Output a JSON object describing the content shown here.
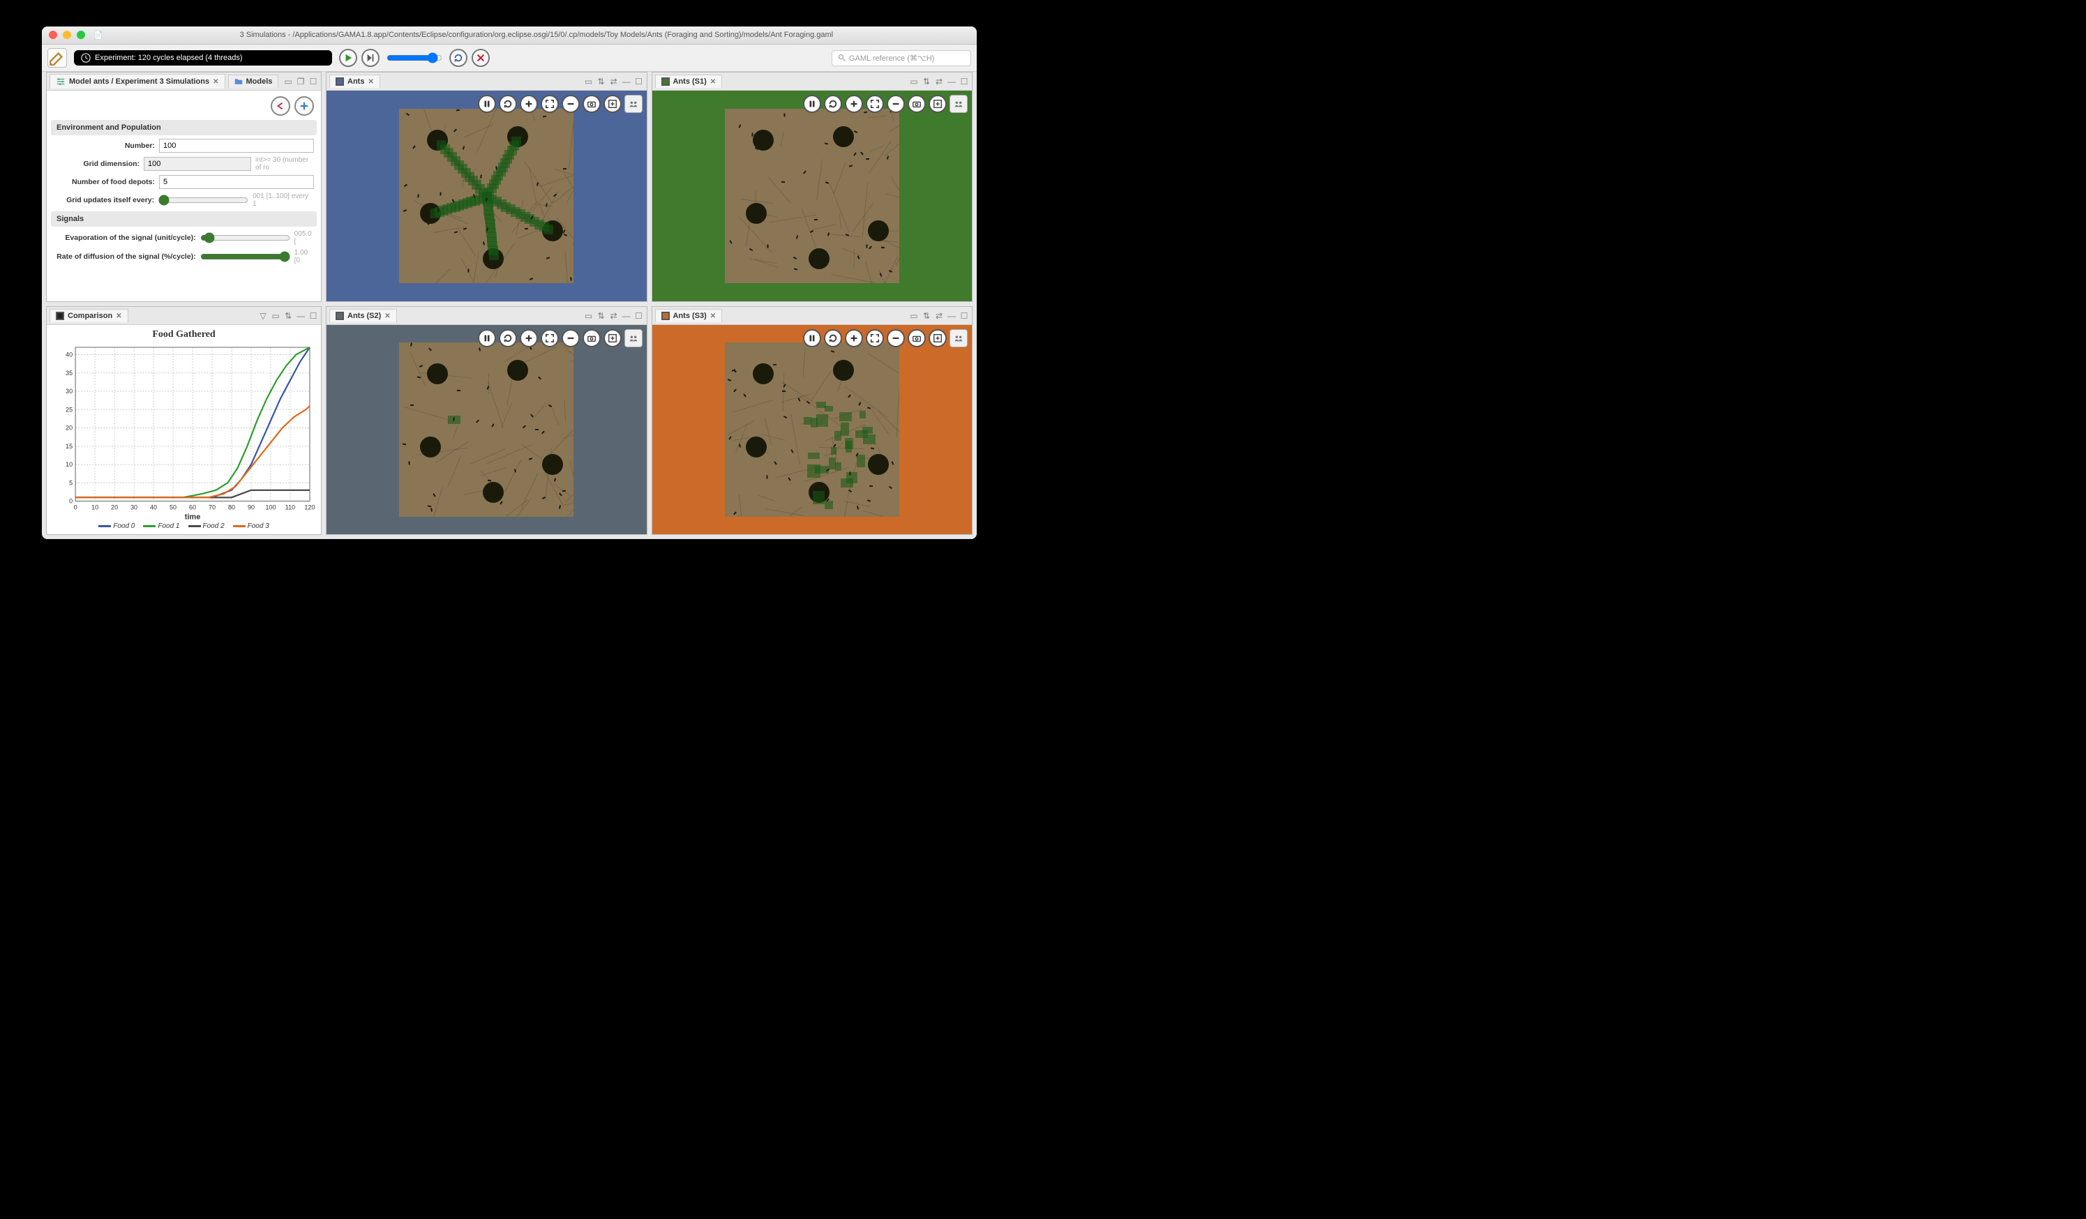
{
  "window": {
    "title": "3 Simulations - /Applications/GAMA1.8.app/Contents/Eclipse/configuration/org.eclipse.osgi/15/0/.cp/models/Toy Models/Ants (Foraging and Sorting)/models/Ant Foraging.gaml"
  },
  "toolbar": {
    "experiment_label": "Experiment: 120 cycles elapsed (4 threads)",
    "search_placeholder": "GAML reference (⌘⌥H)"
  },
  "left_panel": {
    "tab_model": "Model ants / Experiment 3 Simulations",
    "tab_models": "Models",
    "sect_env": "Environment and Population",
    "sect_signals": "Signals",
    "p_number_label": "Number:",
    "p_number_value": "100",
    "p_grid_label": "Grid dimension:",
    "p_grid_value": "100",
    "p_grid_hint": "int>= 30 (number of ro",
    "p_food_label": "Number of food depots:",
    "p_food_value": "5",
    "p_upd_label": "Grid updates itself every:",
    "p_upd_hint": "001 [1..100] every 1",
    "p_evap_label": "Evaporation of the signal (unit/cycle):",
    "p_evap_hint": "005.0 [",
    "p_diff_label": "Rate of diffusion of the signal (%/cycle):",
    "p_diff_hint": "1.00 [0"
  },
  "comparison": {
    "tab": "Comparison"
  },
  "sims": {
    "s0": {
      "tab": "Ants",
      "bg": "#4d6699"
    },
    "s1": {
      "tab": "Ants (S1)",
      "bg": "#3f7a2d"
    },
    "s2": {
      "tab": "Ants (S2)",
      "bg": "#5a6773"
    },
    "s3": {
      "tab": "Ants (S3)",
      "bg": "#cc6a29"
    }
  },
  "chart_data": {
    "type": "line",
    "title": "Food Gathered",
    "xlabel": "time",
    "ylabel": "",
    "xlim": [
      0,
      120
    ],
    "ylim": [
      0,
      42
    ],
    "x_ticks": [
      0,
      10,
      20,
      30,
      40,
      50,
      60,
      70,
      80,
      90,
      100,
      110,
      120
    ],
    "y_ticks": [
      0,
      5,
      10,
      15,
      20,
      25,
      30,
      35,
      40
    ],
    "series": [
      {
        "name": "Food 0",
        "color": "#3955a3",
        "x": [
          0,
          60,
          70,
          75,
          80,
          85,
          90,
          95,
          100,
          105,
          110,
          115,
          120
        ],
        "values": [
          1,
          1,
          1,
          2,
          3,
          6,
          10,
          16,
          22,
          28,
          33,
          38,
          42
        ]
      },
      {
        "name": "Food 1",
        "color": "#2f9e2f",
        "x": [
          0,
          55,
          65,
          72,
          78,
          83,
          88,
          93,
          98,
          103,
          108,
          113,
          120
        ],
        "values": [
          1,
          1,
          2,
          3,
          5,
          9,
          15,
          22,
          28,
          33,
          37,
          40,
          42
        ]
      },
      {
        "name": "Food 2",
        "color": "#4a4a4a",
        "x": [
          0,
          70,
          80,
          85,
          90,
          95,
          120
        ],
        "values": [
          1,
          1,
          1,
          2,
          3,
          3,
          3
        ]
      },
      {
        "name": "Food 3",
        "color": "#e06a1a",
        "x": [
          0,
          68,
          76,
          82,
          88,
          94,
          100,
          106,
          112,
          118,
          120
        ],
        "values": [
          1,
          1,
          2,
          4,
          8,
          12,
          16,
          20,
          23,
          25,
          26
        ]
      }
    ]
  }
}
